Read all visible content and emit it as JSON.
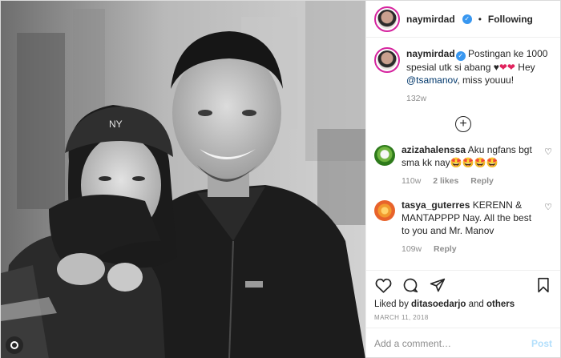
{
  "header": {
    "username": "naymirdad",
    "separator": "•",
    "follow_label": "Following"
  },
  "caption": {
    "username": "naymirdad",
    "text_part1": " Postingan ke 1000 spesial utk si abang ♥",
    "hearts": "❤❤",
    "text_part2": " Hey ",
    "mention": "@tsamanov",
    "text_part3": ", miss youuu!",
    "age": "132w"
  },
  "comments": [
    {
      "username": "azizahalenssa",
      "text": " Aku ngfans bgt sma kk nay🤩🤩🤩🤩",
      "age": "110w",
      "likes": "2 likes",
      "reply": "Reply"
    },
    {
      "username": "tasya_guterres",
      "text": " KERENN & MANTAPPPP Nay. All the best to you and Mr. Manov",
      "age": "109w",
      "reply": "Reply"
    }
  ],
  "likes": {
    "prefix": "Liked by ",
    "user": "ditasoedarjo",
    "and": " and ",
    "others": "others"
  },
  "date": "MARCH 11, 2018",
  "add_comment": {
    "placeholder": "Add a comment…",
    "post_label": "Post"
  },
  "icons": [
    "verified-badge-icon",
    "load-more-icon",
    "heart-icon",
    "comment-icon",
    "share-icon",
    "bookmark-icon"
  ],
  "colors": {
    "link": "#00376b",
    "verified": "#3897f0",
    "muted": "#8e8e8e",
    "post_button": "#b2dffc"
  }
}
